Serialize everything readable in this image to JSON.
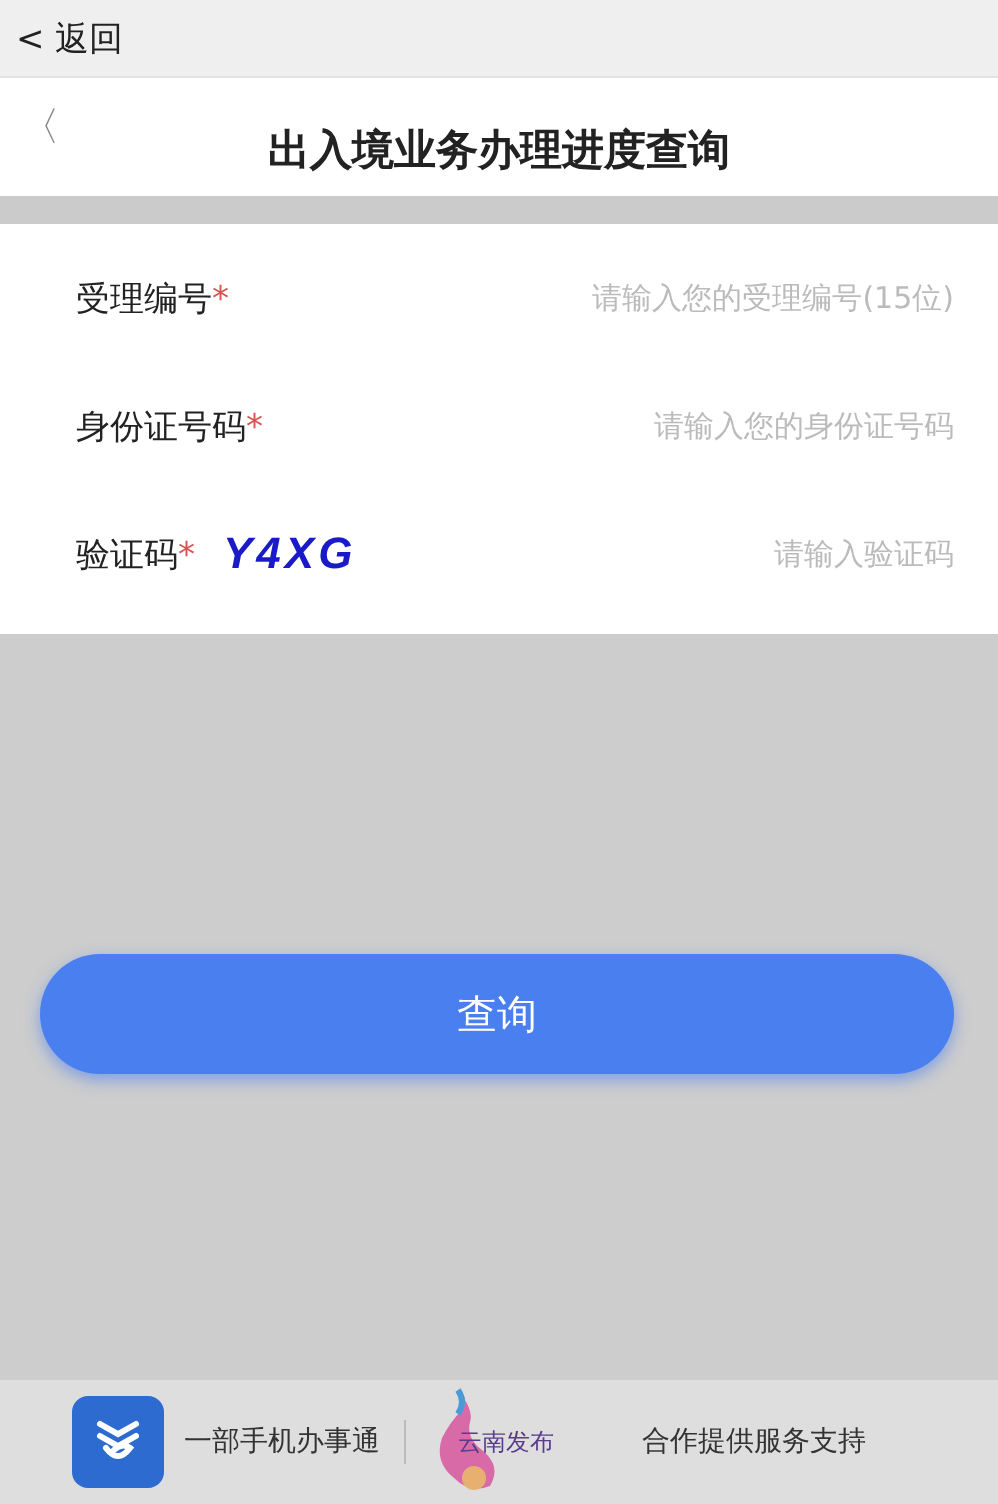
{
  "top_bar": {
    "back_label": "< 返回"
  },
  "header": {
    "back_glyph": "〈",
    "title": "出入境业务办理进度查询"
  },
  "form": {
    "rows": [
      {
        "kind": "text",
        "label": "受理编号",
        "required_mark": "*",
        "placeholder": "请输入您的受理编号(15位)"
      },
      {
        "kind": "text",
        "label": "身份证号码",
        "required_mark": "*",
        "placeholder": "请输入您的身份证号码"
      },
      {
        "kind": "captcha",
        "label": "验证码",
        "required_mark": "*",
        "captcha": "Y4XG",
        "placeholder": "请输入验证码"
      }
    ]
  },
  "submit_button": {
    "label": "查询"
  },
  "footer": {
    "app_name": "一部手机办事通",
    "partner_logo_text": "云南发布",
    "note": "合作提供服务支持"
  }
}
